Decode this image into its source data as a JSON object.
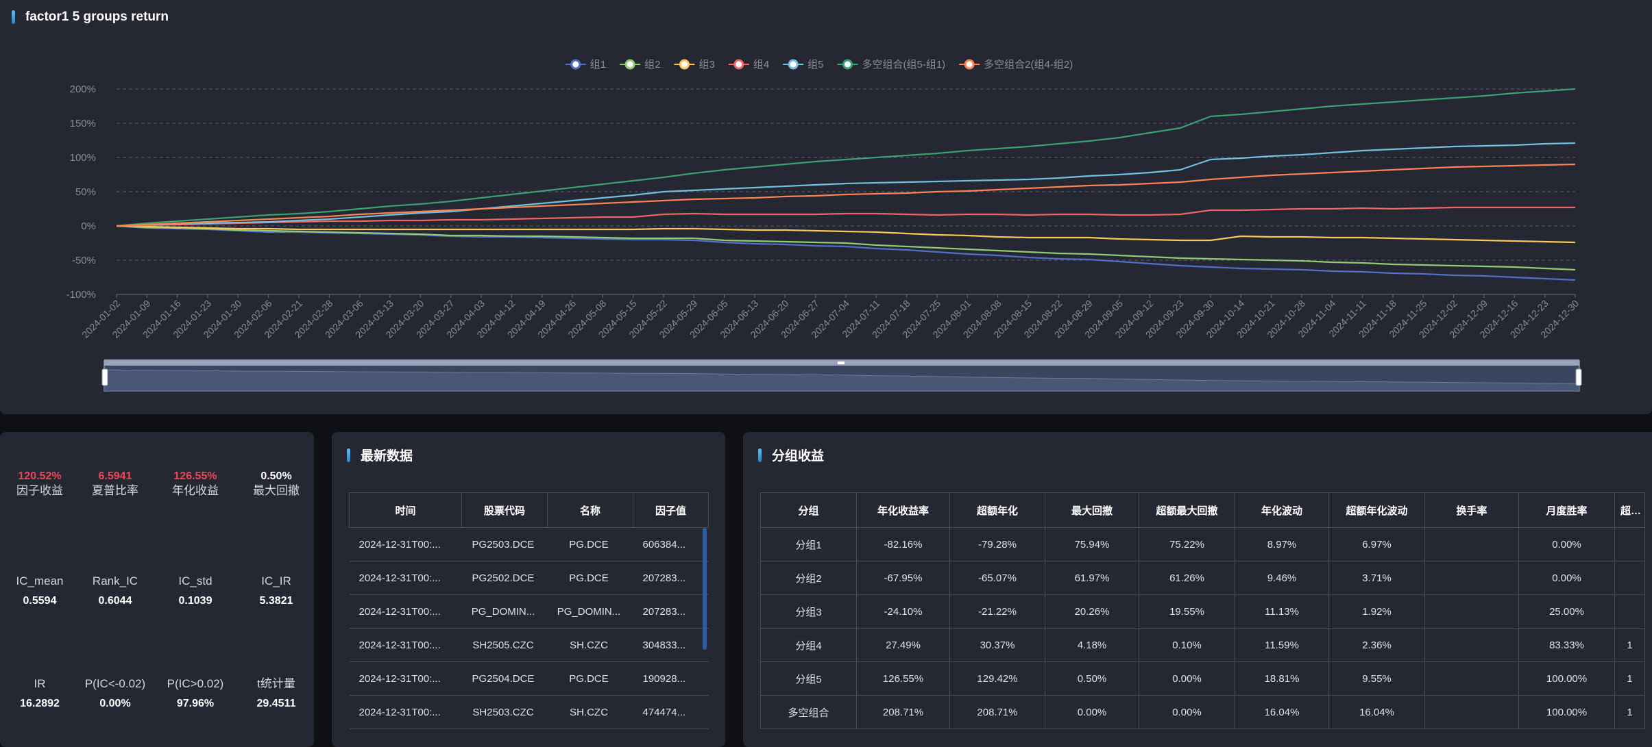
{
  "chart_panel": {
    "title": "factor1 5 groups return"
  },
  "chart_data": {
    "type": "line",
    "ylim": [
      -100,
      200
    ],
    "y_ticks": [
      "200%",
      "150%",
      "100%",
      "50%",
      "0%",
      "-50%",
      "-100%"
    ],
    "x_ticks": [
      "2024-01-02",
      "2024-01-09",
      "2024-01-16",
      "2024-01-23",
      "2024-01-30",
      "2024-02-06",
      "2024-02-21",
      "2024-02-28",
      "2024-03-06",
      "2024-03-13",
      "2024-03-20",
      "2024-03-27",
      "2024-04-03",
      "2024-04-12",
      "2024-04-19",
      "2024-04-26",
      "2024-05-08",
      "2024-05-15",
      "2024-05-22",
      "2024-05-29",
      "2024-06-05",
      "2024-06-13",
      "2024-06-20",
      "2024-06-27",
      "2024-07-04",
      "2024-07-11",
      "2024-07-18",
      "2024-07-25",
      "2024-08-01",
      "2024-08-08",
      "2024-08-15",
      "2024-08-22",
      "2024-08-29",
      "2024-09-05",
      "2024-09-12",
      "2024-09-23",
      "2024-09-30",
      "2024-10-14",
      "2024-10-21",
      "2024-10-28",
      "2024-11-04",
      "2024-11-11",
      "2024-11-18",
      "2024-11-25",
      "2024-12-02",
      "2024-12-09",
      "2024-12-16",
      "2024-12-23",
      "2024-12-30"
    ],
    "grid": true,
    "legend": "top-center",
    "series": [
      {
        "name": "组1",
        "color": "#5470c6",
        "values": [
          0,
          -3,
          -4,
          -5,
          -7,
          -9,
          -9,
          -10,
          -11,
          -12,
          -13,
          -15,
          -16,
          -16,
          -17,
          -18,
          -19,
          -20,
          -20,
          -21,
          -24,
          -26,
          -27,
          -29,
          -30,
          -33,
          -35,
          -38,
          -41,
          -43,
          -46,
          -48,
          -49,
          -52,
          -55,
          -58,
          -60,
          -62,
          -63,
          -64,
          -66,
          -67,
          -69,
          -70,
          -72,
          -73,
          -75,
          -77,
          -79
        ]
      },
      {
        "name": "组2",
        "color": "#91cc75",
        "values": [
          0,
          -2,
          -3,
          -4,
          -6,
          -7,
          -8,
          -9,
          -10,
          -11,
          -12,
          -14,
          -14,
          -15,
          -15,
          -16,
          -17,
          -18,
          -18,
          -18,
          -21,
          -22,
          -23,
          -24,
          -25,
          -28,
          -30,
          -32,
          -34,
          -36,
          -38,
          -40,
          -41,
          -43,
          -45,
          -47,
          -48,
          -49,
          -50,
          -51,
          -53,
          -54,
          -56,
          -57,
          -58,
          -59,
          -60,
          -62,
          -64
        ]
      },
      {
        "name": "组3",
        "color": "#fac858",
        "values": [
          0,
          -1,
          -2,
          -3,
          -4,
          -4,
          -5,
          -5,
          -5,
          -5,
          -5,
          -5,
          -5,
          -5,
          -5,
          -5,
          -5,
          -5,
          -4,
          -4,
          -5,
          -6,
          -6,
          -7,
          -8,
          -9,
          -11,
          -13,
          -14,
          -16,
          -17,
          -17,
          -17,
          -19,
          -20,
          -21,
          -21,
          -15,
          -16,
          -16,
          -17,
          -17,
          -18,
          -19,
          -20,
          -21,
          -22,
          -23,
          -24
        ]
      },
      {
        "name": "组4",
        "color": "#ee6666",
        "values": [
          0,
          1,
          2,
          3,
          4,
          5,
          6,
          7,
          7,
          8,
          8,
          9,
          9,
          10,
          11,
          12,
          13,
          13,
          17,
          18,
          17,
          17,
          17,
          17,
          18,
          18,
          17,
          16,
          17,
          17,
          16,
          17,
          17,
          16,
          16,
          17,
          23,
          23,
          24,
          25,
          25,
          26,
          25,
          26,
          27,
          27,
          27,
          27,
          27
        ]
      },
      {
        "name": "组5",
        "color": "#73c0de",
        "values": [
          0,
          2,
          3,
          4,
          5,
          6,
          8,
          10,
          13,
          16,
          19,
          21,
          25,
          29,
          33,
          37,
          41,
          45,
          50,
          52,
          54,
          56,
          58,
          60,
          62,
          63,
          64,
          65,
          66,
          67,
          68,
          70,
          73,
          75,
          78,
          82,
          97,
          99,
          102,
          104,
          107,
          110,
          112,
          114,
          116,
          117,
          118,
          120,
          121
        ]
      },
      {
        "name": "多空组合(组5-组1)",
        "color": "#3ba272",
        "values": [
          0,
          4,
          7,
          10,
          13,
          16,
          18,
          21,
          25,
          29,
          32,
          36,
          41,
          46,
          51,
          56,
          61,
          66,
          71,
          77,
          82,
          86,
          90,
          94,
          97,
          100,
          103,
          106,
          110,
          113,
          116,
          120,
          124,
          129,
          136,
          143,
          160,
          163,
          167,
          171,
          175,
          178,
          181,
          184,
          187,
          190,
          194,
          197,
          200
        ]
      },
      {
        "name": "多空组合2(组4-组2)",
        "color": "#fc8452",
        "values": [
          0,
          2,
          4,
          6,
          8,
          10,
          12,
          14,
          17,
          19,
          21,
          23,
          25,
          27,
          29,
          31,
          33,
          35,
          37,
          39,
          40,
          41,
          43,
          44,
          46,
          47,
          48,
          50,
          51,
          53,
          55,
          57,
          59,
          60,
          62,
          64,
          68,
          71,
          74,
          76,
          78,
          80,
          82,
          84,
          86,
          87,
          88,
          89,
          90
        ]
      }
    ]
  },
  "stats": [
    [
      {
        "value": "120.52%",
        "label": "因子收益",
        "red": true
      },
      {
        "value": "6.5941",
        "label": "夏普比率",
        "red": true
      },
      {
        "value": "126.55%",
        "label": "年化收益",
        "red": true
      },
      {
        "value": "0.50%",
        "label": "最大回撤",
        "red": false
      }
    ],
    [
      {
        "value": "0.5594",
        "label": "IC_mean",
        "red": false
      },
      {
        "value": "0.6044",
        "label": "Rank_IC",
        "red": false
      },
      {
        "value": "0.1039",
        "label": "IC_std",
        "red": false
      },
      {
        "value": "5.3821",
        "label": "IC_IR",
        "red": false
      }
    ],
    [
      {
        "value": "16.2892",
        "label": "IR",
        "red": false
      },
      {
        "value": "0.00%",
        "label": "P(IC<-0.02)",
        "red": false
      },
      {
        "value": "97.96%",
        "label": "P(IC>0.02)",
        "red": false
      },
      {
        "value": "29.4511",
        "label": "t统计量",
        "red": false
      }
    ]
  ],
  "latest": {
    "title": "最新数据",
    "headers": [
      "时间",
      "股票代码",
      "名称",
      "因子值"
    ],
    "rows": [
      [
        "2024-12-31T00:...",
        "PG2503.DCE",
        "PG.DCE",
        "606384..."
      ],
      [
        "2024-12-31T00:...",
        "PG2502.DCE",
        "PG.DCE",
        "207283..."
      ],
      [
        "2024-12-31T00:...",
        "PG_DOMIN...",
        "PG_DOMIN...",
        "207283..."
      ],
      [
        "2024-12-31T00:...",
        "SH2505.CZC",
        "SH.CZC",
        "304833..."
      ],
      [
        "2024-12-31T00:...",
        "PG2504.DCE",
        "PG.DCE",
        "190928..."
      ],
      [
        "2024-12-31T00:...",
        "SH2503.CZC",
        "SH.CZC",
        "474474..."
      ]
    ]
  },
  "groups": {
    "title": "分组收益",
    "headers": [
      "分组",
      "年化收益率",
      "超额年化",
      "最大回撤",
      "超额最大回撤",
      "年化波动",
      "超额年化波动",
      "换手率",
      "月度胜率",
      "超额"
    ],
    "rows": [
      [
        "分组1",
        "-82.16%",
        "-79.28%",
        "75.94%",
        "75.22%",
        "8.97%",
        "6.97%",
        "",
        "0.00%",
        ""
      ],
      [
        "分组2",
        "-67.95%",
        "-65.07%",
        "61.97%",
        "61.26%",
        "9.46%",
        "3.71%",
        "",
        "0.00%",
        ""
      ],
      [
        "分组3",
        "-24.10%",
        "-21.22%",
        "20.26%",
        "19.55%",
        "11.13%",
        "1.92%",
        "",
        "25.00%",
        ""
      ],
      [
        "分组4",
        "27.49%",
        "30.37%",
        "4.18%",
        "0.10%",
        "11.59%",
        "2.36%",
        "",
        "83.33%",
        "1"
      ],
      [
        "分组5",
        "126.55%",
        "129.42%",
        "0.50%",
        "0.00%",
        "18.81%",
        "9.55%",
        "",
        "100.00%",
        "1"
      ],
      [
        "多空组合",
        "208.71%",
        "208.71%",
        "0.00%",
        "0.00%",
        "16.04%",
        "16.04%",
        "",
        "100.00%",
        "1"
      ]
    ]
  }
}
